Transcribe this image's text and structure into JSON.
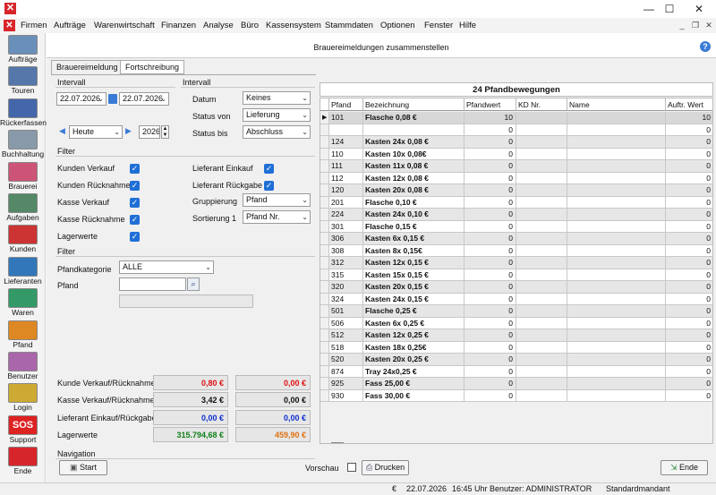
{
  "window": {
    "min_btn": "—",
    "max_btn": "☐",
    "close_btn": "✕",
    "app_icon": "✕"
  },
  "menu": [
    "Firmen",
    "Aufträge",
    "Warenwirtschaft",
    "Finanzen",
    "Analyse",
    "Büro",
    "Kassensystem",
    "Stammdaten",
    "Optionen",
    "Fenster",
    "Hilfe"
  ],
  "mdi": {
    "min": "_",
    "restore": "❐",
    "close": "✕"
  },
  "sidebar": [
    {
      "label": "Aufträge",
      "icon": "orders-icon",
      "color": "#6a8fb8"
    },
    {
      "label": "Touren",
      "icon": "truck-icon",
      "color": "#5577aa"
    },
    {
      "label": "Rückerfassen",
      "icon": "truck-return-icon",
      "color": "#4466aa"
    },
    {
      "label": "Buchhaltung",
      "icon": "accounting-icon",
      "color": "#8899aa"
    },
    {
      "label": "Brauerei",
      "icon": "brewery-icon",
      "color": "#cc5577"
    },
    {
      "label": "Aufgaben",
      "icon": "tasks-icon",
      "color": "#558866"
    },
    {
      "label": "Kunden",
      "icon": "customers-icon",
      "color": "#cc3333"
    },
    {
      "label": "Lieferanten",
      "icon": "suppliers-icon",
      "color": "#3377bb"
    },
    {
      "label": "Waren",
      "icon": "goods-icon",
      "color": "#339966"
    },
    {
      "label": "Pfand",
      "icon": "deposit-icon",
      "color": "#dd8822"
    },
    {
      "label": "Benutzer",
      "icon": "user-icon",
      "color": "#aa66aa"
    },
    {
      "label": "Login",
      "icon": "login-key-icon",
      "color": "#ccaa33"
    },
    {
      "label": "Support",
      "icon": "sos-icon",
      "color": "#dd2222",
      "text": "SOS"
    },
    {
      "label": "Ende",
      "icon": "power-icon",
      "color": "#d7262b"
    }
  ],
  "header": {
    "title": "Brauereimeldungen zusammenstellen",
    "help_icon": "?"
  },
  "tabs": [
    "Brauereimeldung",
    "Fortschreibung"
  ],
  "interval1": {
    "title": "Intervall",
    "from": "22.07.2026",
    "to": "22.07.2026",
    "period": "Heute",
    "year": "2026"
  },
  "interval2": {
    "title": "Intervall",
    "datum_label": "Datum",
    "datum": "Keines",
    "status_von_label": "Status von",
    "status_von": "Lieferung",
    "status_bis_label": "Status bis",
    "status_bis": "Abschluss"
  },
  "filter1": {
    "title": "Filter",
    "left": [
      {
        "label": "Kunden Verkauf",
        "checked": true
      },
      {
        "label": "Kunden Rücknahme",
        "checked": true
      },
      {
        "label": "Kasse Verkauf",
        "checked": true
      },
      {
        "label": "Kasse Rücknahme",
        "checked": true
      },
      {
        "label": "Lagerwerte",
        "checked": true
      }
    ],
    "right": [
      {
        "label": "Lieferant Einkauf",
        "checked": true
      },
      {
        "label": "Lieferant Rückgabe",
        "checked": true
      }
    ],
    "gruppierung_label": "Gruppierung",
    "gruppierung": "Pfand",
    "sortierung_label": "Sortierung 1",
    "sortierung": "Pfand Nr."
  },
  "filter2": {
    "title": "Filter",
    "kategorie_label": "Pfandkategorie",
    "kategorie": "ALLE",
    "pfand_label": "Pfand",
    "pfand": ""
  },
  "totals": [
    {
      "label": "Kunde Verkauf/Rücknahme",
      "v1": "0,80 €",
      "v2": "0,00 €",
      "c1": "#e01010",
      "c2": "#e01010"
    },
    {
      "label": "Kasse Verkauf/Rücknahme",
      "v1": "3,42 €",
      "v2": "0,00 €",
      "c1": "#111111",
      "c2": "#111111"
    },
    {
      "label": "Lieferant Einkauf/Rückgabe",
      "v1": "0,00 €",
      "v2": "0,00 €",
      "c1": "#1030d0",
      "c2": "#1030d0"
    },
    {
      "label": "Lagerwerte",
      "v1": "315.794,68 €",
      "v2": "459,90 €",
      "c1": "#10801a",
      "c2": "#e07010"
    }
  ],
  "grid": {
    "title": "24 Pfandbewegungen",
    "columns": [
      "Pfand",
      "Bezeichnung",
      "Pfandwert",
      "KD Nr.",
      "Name",
      "Auftr. Wert"
    ],
    "rows": [
      [
        "101",
        "Flasche 0,08 €",
        "10",
        "",
        "",
        "10"
      ],
      [
        "",
        "",
        "0",
        "",
        "",
        "0"
      ],
      [
        "124",
        "Kasten 24x 0,08 €",
        "0",
        "",
        "",
        "0"
      ],
      [
        "110",
        "Kasten 10x 0,08€",
        "0",
        "",
        "",
        "0"
      ],
      [
        "111",
        "Kasten 11x 0,08 €",
        "0",
        "",
        "",
        "0"
      ],
      [
        "112",
        "Kasten 12x 0,08 €",
        "0",
        "",
        "",
        "0"
      ],
      [
        "120",
        "Kasten 20x 0,08 €",
        "0",
        "",
        "",
        "0"
      ],
      [
        "201",
        "Flasche 0,10 €",
        "0",
        "",
        "",
        "0"
      ],
      [
        "224",
        "Kasten 24x 0,10 €",
        "0",
        "",
        "",
        "0"
      ],
      [
        "301",
        "Flasche 0,15 €",
        "0",
        "",
        "",
        "0"
      ],
      [
        "306",
        "Kasten 6x 0,15 €",
        "0",
        "",
        "",
        "0"
      ],
      [
        "308",
        "Kasten 8x 0,15€",
        "0",
        "",
        "",
        "0"
      ],
      [
        "312",
        "Kasten 12x 0,15 €",
        "0",
        "",
        "",
        "0"
      ],
      [
        "315",
        "Kasten 15x 0,15 €",
        "0",
        "",
        "",
        "0"
      ],
      [
        "320",
        "Kasten 20x 0,15 €",
        "0",
        "",
        "",
        "0"
      ],
      [
        "324",
        "Kasten 24x 0,15 €",
        "0",
        "",
        "",
        "0"
      ],
      [
        "501",
        "Flasche 0,25 €",
        "0",
        "",
        "",
        "0"
      ],
      [
        "506",
        "Kasten 6x 0,25 €",
        "0",
        "",
        "",
        "0"
      ],
      [
        "512",
        "Kasten 12x 0,25 €",
        "0",
        "",
        "",
        "0"
      ],
      [
        "518",
        "Kasten 18x 0,25€",
        "0",
        "",
        "",
        "0"
      ],
      [
        "520",
        "Kasten 20x 0,25 €",
        "0",
        "",
        "",
        "0"
      ],
      [
        "874",
        "Tray 24x0,25 €",
        "0",
        "",
        "",
        "0"
      ],
      [
        "925",
        "Fass 25,00 €",
        "0",
        "",
        "",
        "0"
      ],
      [
        "930",
        "Fass 30,00 €",
        "0",
        "",
        "",
        "0"
      ]
    ]
  },
  "navigation": {
    "title": "Navigation",
    "start": "Start",
    "vorschau": "Vorschau",
    "drucken": "Drucken",
    "ende": "Ende"
  },
  "status": {
    "euro": "€",
    "date": "22.07.2026",
    "time": "16:45 Uhr",
    "user": "Benutzer: ADMINISTRATOR",
    "mandant": "Standardmandant"
  }
}
